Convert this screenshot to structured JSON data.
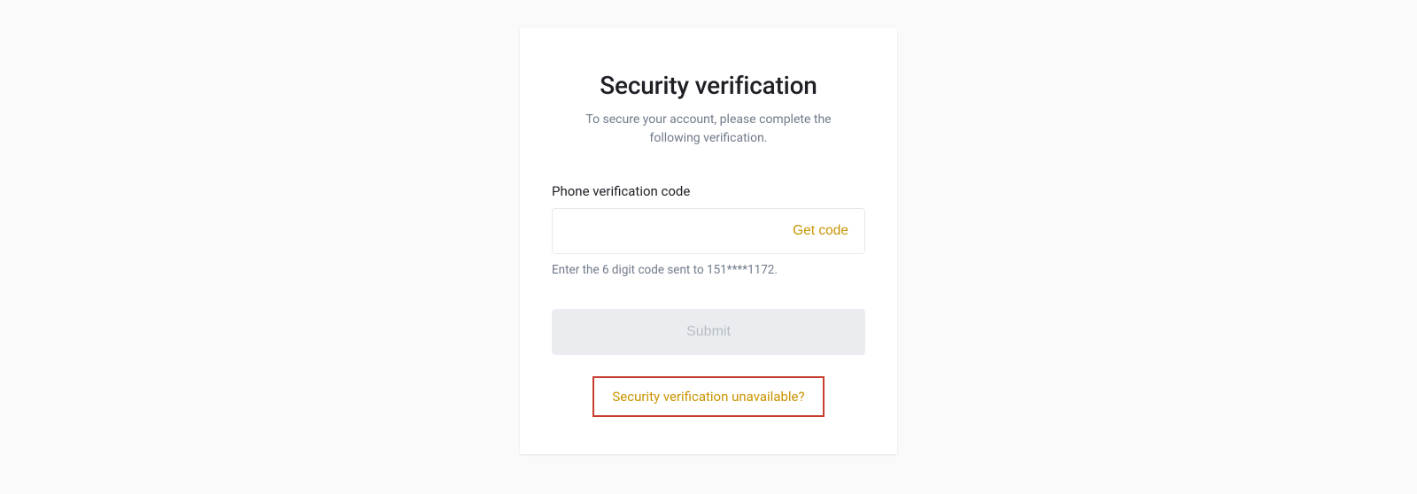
{
  "card": {
    "title": "Security verification",
    "subtitle": "To secure your account, please complete the following verification.",
    "field_label": "Phone verification code",
    "input_value": "",
    "get_code_label": "Get code",
    "helper_text": "Enter the 6 digit code sent to 151****1172.",
    "submit_label": "Submit",
    "unavailable_link": "Security verification unavailable?"
  },
  "colors": {
    "accent": "#c99400",
    "highlight_border": "#c73e2e",
    "disabled_bg": "#eaecef",
    "disabled_text": "#b7bdc6"
  }
}
